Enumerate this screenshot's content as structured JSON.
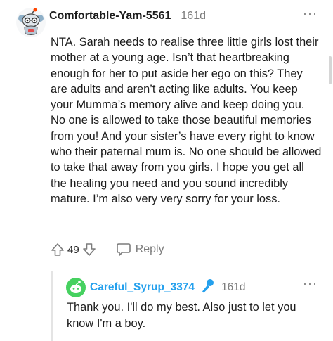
{
  "comment": {
    "username": "Comfortable-Yam-5561",
    "time": "161d",
    "more_icon": "···",
    "body": "NTA. Sarah needs to realise three little girls lost their mother at a young age. Isn’t that heartbreaking enough for her to put aside her ego on this? They are adults and aren’t acting like adults. You keep your Mumma’s memory alive and keep doing you. No one is allowed to take those beautiful memories from you! And your sister’s have every right to know who their paternal mum is. No one should be allowed to take that away from you girls. I hope you get all the healing you need and you sound incredibly mature. I’m also very very sorry for your loss.",
    "votes": "49",
    "reply_label": "Reply"
  },
  "reply": {
    "username": "Careful_Syrup_3374",
    "time": "161d",
    "more_icon": "···",
    "body": "Thank you. I'll do my best. Also just to let you know I'm a boy."
  },
  "colors": {
    "username_reply": "#24a0ed",
    "mod_icon": "#24a0ed",
    "meta_gray": "#7c7c7c",
    "avatar_green": "#46d160"
  },
  "icons": {
    "avatar_top": "snoo-avatar-icon",
    "avatar_reply": "snoo-avatar-icon",
    "upvote": "upvote-arrow-icon",
    "downvote": "downvote-arrow-icon",
    "reply": "speech-bubble-icon",
    "mod": "microphone-icon"
  }
}
